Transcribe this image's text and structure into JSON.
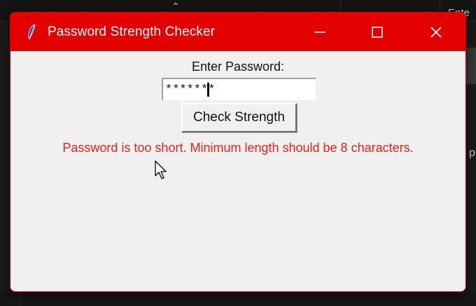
{
  "window": {
    "title": "Password Strength Checker",
    "icon": "feather-icon",
    "controls": {
      "minimize": "minimize-icon",
      "maximize": "maximize-icon",
      "close": "close-icon"
    },
    "accent_color": "#e30000"
  },
  "form": {
    "prompt_label": "Enter Password:",
    "password_value": "*******",
    "check_button_label": "Check Strength"
  },
  "result": {
    "message": "Password is too short. Minimum length should be 8 characters.",
    "color": "#e0231c"
  },
  "background": {
    "right_edge_text": "Ente",
    "right_edge_letter": "p"
  }
}
